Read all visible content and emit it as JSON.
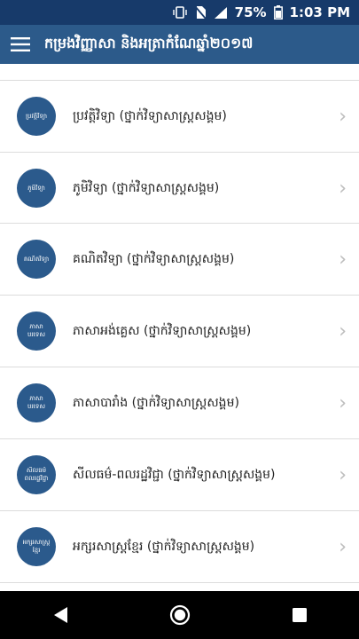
{
  "status_bar": {
    "battery_percent": "75%",
    "time": "1:03 PM",
    "icons": [
      "vibrate-icon",
      "no-sim-icon",
      "signal-icon",
      "battery-icon"
    ]
  },
  "app_bar": {
    "title": "កម្រងវិញ្ញាសា និងអត្រាកំណែឆ្នាំ២០១៧",
    "menu_icon": "hamburger-menu-icon"
  },
  "list": {
    "items": [
      {
        "label": "ប្រវត្តិវិទ្យា (ថ្នាក់វិទ្យាសាស្ត្រសង្គម)",
        "badge_lines": [
          "ប្រវត្តិវិទ្យា"
        ]
      },
      {
        "label": "ភូមិវិទ្យា (ថ្នាក់វិទ្យាសាស្ត្រសង្គម)",
        "badge_lines": [
          "ភូមិវិទ្យា"
        ]
      },
      {
        "label": "គណិតវិទ្យា (ថ្នាក់វិទ្យាសាស្ត្រសង្គម)",
        "badge_lines": [
          "គណិតវិទ្យា"
        ]
      },
      {
        "label": "ភាសាអង់គ្លេស (ថ្នាក់វិទ្យាសាស្ត្រសង្គម)",
        "badge_lines": [
          "ភាសា",
          "បរទេស"
        ]
      },
      {
        "label": "ភាសាបារាំង (ថ្នាក់វិទ្យាសាស្ត្រសង្គម)",
        "badge_lines": [
          "ភាសា",
          "បរទេស"
        ]
      },
      {
        "label": "សីលធម៌-ពលរដ្ឋវិជ្ជា (ថ្នាក់វិទ្យាសាស្ត្រសង្គម)",
        "badge_lines": [
          "សីលធម៌",
          "ពលរដ្ឋវិជ្ជា"
        ]
      },
      {
        "label": "អក្សរសាស្ត្រខ្មែរ (ថ្នាក់វិទ្យាសាស្ត្រសង្គម)",
        "badge_lines": [
          "អក្សរសាស្ត្រ",
          "ខ្មែរ"
        ]
      }
    ],
    "chevron": "›"
  },
  "nav_bar": {
    "icons": [
      "back-icon",
      "home-icon",
      "recents-icon"
    ]
  }
}
